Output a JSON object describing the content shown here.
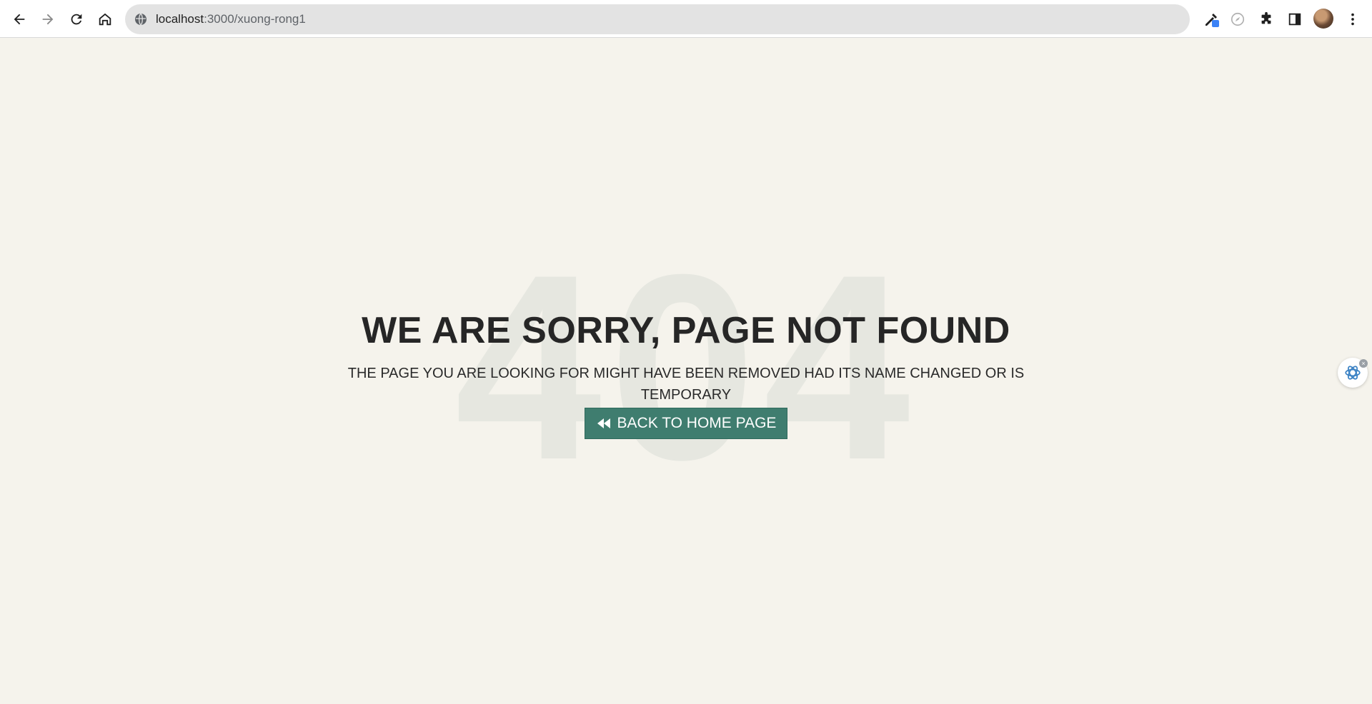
{
  "browser": {
    "url_host": "localhost",
    "url_path": ":3000/xuong-rong1"
  },
  "page": {
    "background_number": "404",
    "title": "WE ARE SORRY, PAGE NOT FOUND",
    "subtitle": "THE PAGE YOU ARE LOOKING FOR MIGHT HAVE BEEN REMOVED HAD ITS NAME CHANGED OR IS TEMPORARY",
    "home_button_label": "BACK TO HOME PAGE",
    "home_button_icon": "backward-icon"
  },
  "colors": {
    "page_background": "#f5f3ec",
    "button_background": "#3f7d6f",
    "title_color": "#262626",
    "background_number_color": "#e6e7e0"
  }
}
